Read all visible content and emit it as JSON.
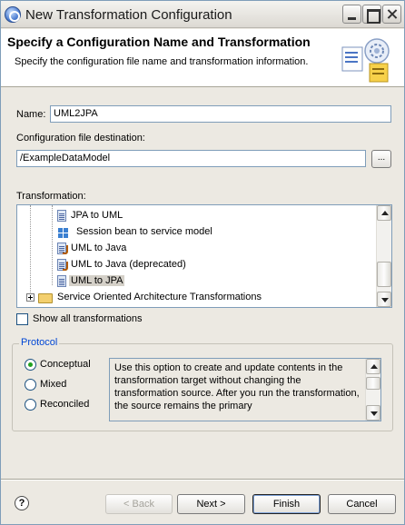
{
  "window": {
    "title": "New Transformation Configuration"
  },
  "banner": {
    "title": "Specify a Configuration Name and Transformation",
    "description": "Specify the configuration file name and transformation information.",
    "icon": "wizard-config-icon"
  },
  "form": {
    "name_label": "Name:",
    "name_value": "UML2JPA",
    "destination_label": "Configuration file destination:",
    "destination_value": "/ExampleDataModel",
    "browse_label": "...",
    "transformation_label": "Transformation:"
  },
  "tree": {
    "items": [
      {
        "label": "JPA to UML",
        "icon": "transform-icon"
      },
      {
        "label": "Session bean to service model",
        "icon": "service-model-icon"
      },
      {
        "label": "UML to Java",
        "icon": "java-transform-icon"
      },
      {
        "label": "UML to Java (deprecated)",
        "icon": "java-transform-icon"
      },
      {
        "label": "UML to JPA",
        "icon": "transform-icon",
        "selected": true
      },
      {
        "label": "Service Oriented Architecture Transformations",
        "icon": "folder-icon",
        "expandable": true
      }
    ]
  },
  "show_all": {
    "label": "Show all transformations",
    "checked": false
  },
  "protocol": {
    "legend": "Protocol",
    "options": [
      {
        "label": "Conceptual",
        "checked": true
      },
      {
        "label": "Mixed",
        "checked": false
      },
      {
        "label": "Reconciled",
        "checked": false
      }
    ],
    "description": "Use this option to create and update contents in the transformation target without changing the transformation source. After you run the transformation, the source remains the primary"
  },
  "buttons": {
    "help": "?",
    "back": "< Back",
    "next": "Next >",
    "finish": "Finish",
    "cancel": "Cancel"
  },
  "colors": {
    "window_bg": "#ece9e2",
    "legend_blue": "#0046d5",
    "radio_green": "#21a121",
    "field_border": "#7f9db9"
  }
}
